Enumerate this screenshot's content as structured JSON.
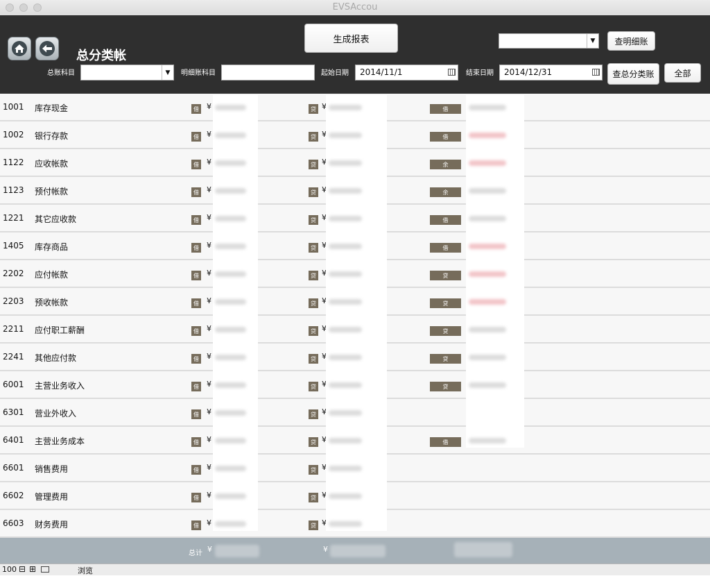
{
  "window": {
    "title": "EVSAccou"
  },
  "header": {
    "title": "总分类帐",
    "generate_report": "生成报表",
    "account_dropdown_value": "",
    "view_detail": "查明细账",
    "ledger_account_label": "总账科目",
    "ledger_account_value": "",
    "detail_account_label": "明细账科目",
    "detail_account_value": "",
    "start_date_label": "起始日期",
    "start_date": "2014/11/1",
    "end_date_label": "结束日期",
    "end_date": "2014/12/31",
    "view_general": "查总分类账",
    "all": "全部"
  },
  "icons": {
    "home": "home-icon",
    "back": "back-arrow-icon",
    "calendar": "calendar-icon"
  },
  "colors": {
    "tag": "#766c5b",
    "header": "#2f2f2f",
    "total_bar": "#a6b1b8"
  },
  "rows": [
    {
      "code": "1001",
      "name": "库存现金",
      "debit_tag": "借",
      "credit_tag": "贷",
      "dir": "借"
    },
    {
      "code": "1002",
      "name": "银行存款",
      "debit_tag": "借",
      "credit_tag": "贷",
      "dir": "借"
    },
    {
      "code": "1122",
      "name": "应收帐款",
      "debit_tag": "借",
      "credit_tag": "贷",
      "dir": "余"
    },
    {
      "code": "1123",
      "name": "预付帐款",
      "debit_tag": "借",
      "credit_tag": "贷",
      "dir": "余"
    },
    {
      "code": "1221",
      "name": "其它应收款",
      "debit_tag": "借",
      "credit_tag": "贷",
      "dir": "借"
    },
    {
      "code": "1405",
      "name": "库存商品",
      "debit_tag": "借",
      "credit_tag": "贷",
      "dir": "借"
    },
    {
      "code": "2202",
      "name": "应付帐款",
      "debit_tag": "借",
      "credit_tag": "贷",
      "dir": "贷"
    },
    {
      "code": "2203",
      "name": "预收帐款",
      "debit_tag": "借",
      "credit_tag": "贷",
      "dir": "贷"
    },
    {
      "code": "2211",
      "name": "应付职工薪酬",
      "debit_tag": "借",
      "credit_tag": "贷",
      "dir": "贷"
    },
    {
      "code": "2241",
      "name": "其他应付款",
      "debit_tag": "借",
      "credit_tag": "贷",
      "dir": "贷"
    },
    {
      "code": "6001",
      "name": "主营业务收入",
      "debit_tag": "借",
      "credit_tag": "贷",
      "dir": "贷"
    },
    {
      "code": "6301",
      "name": "营业外收入",
      "debit_tag": "借",
      "credit_tag": "贷",
      "dir": ""
    },
    {
      "code": "6401",
      "name": "主营业务成本",
      "debit_tag": "借",
      "credit_tag": "贷",
      "dir": "借"
    },
    {
      "code": "6601",
      "name": "销售费用",
      "debit_tag": "借",
      "credit_tag": "贷",
      "dir": ""
    },
    {
      "code": "6602",
      "name": "管理费用",
      "debit_tag": "借",
      "credit_tag": "贷",
      "dir": ""
    },
    {
      "code": "6603",
      "name": "财务费用",
      "debit_tag": "借",
      "credit_tag": "贷",
      "dir": ""
    }
  ],
  "currency": "¥",
  "footer": {
    "total_label": "总计",
    "currency": "¥"
  },
  "status": {
    "zoom": "100",
    "mode": "浏览"
  }
}
